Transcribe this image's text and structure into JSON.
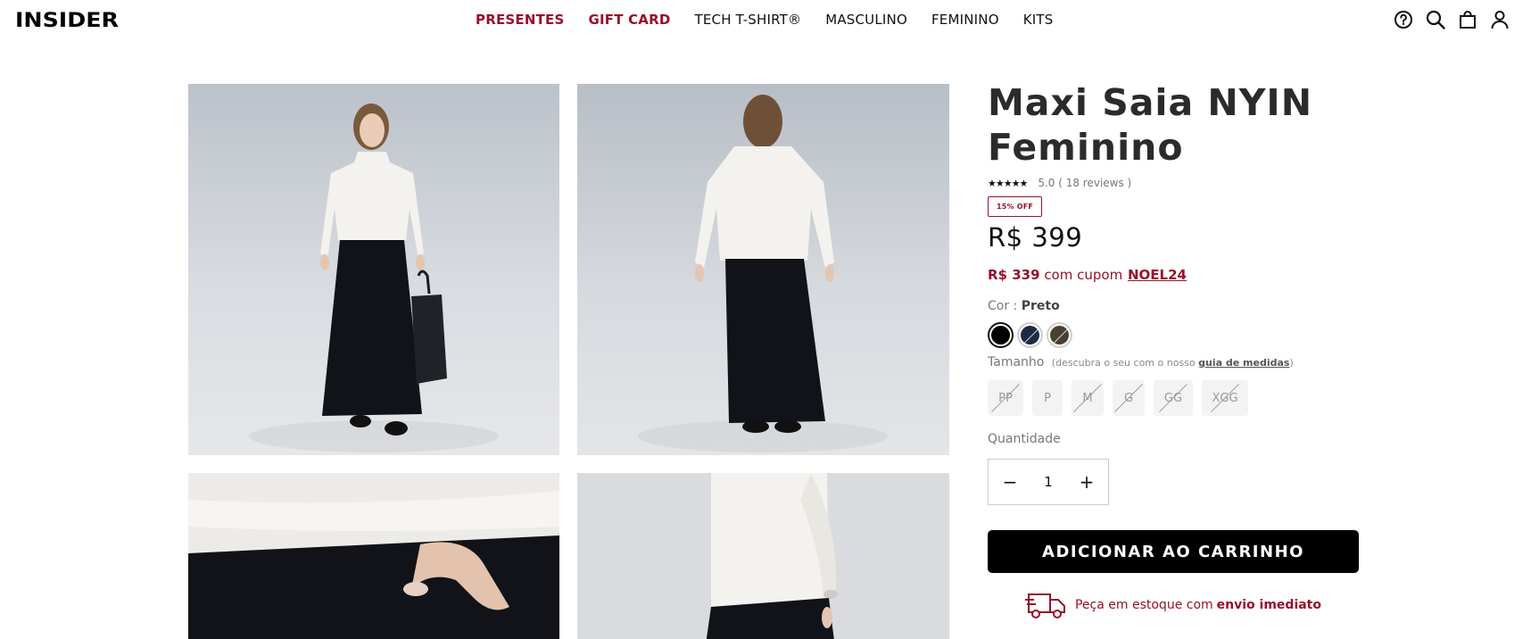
{
  "header": {
    "logo": "INSIDER",
    "nav": [
      {
        "label": "PRESENTES",
        "accent": true
      },
      {
        "label": "GIFT CARD",
        "accent": true
      },
      {
        "label": "TECH T-SHIRT®",
        "accent": false
      },
      {
        "label": "MASCULINO",
        "accent": false
      },
      {
        "label": "FEMININO",
        "accent": false
      },
      {
        "label": "KITS",
        "accent": false
      }
    ],
    "icons": [
      "help-icon",
      "search-icon",
      "bag-icon",
      "user-icon"
    ]
  },
  "gallery": {
    "photos": [
      "front-view-photo",
      "back-view-photo",
      "pocket-detail-photo",
      "side-detail-photo"
    ]
  },
  "product": {
    "title": "Maxi Saia NYIN Feminino",
    "stars": "★★★★★",
    "rating": "5.0 ( 18 reviews )",
    "discount_badge": "15% OFF",
    "price": "R$ 399",
    "coupon": {
      "price": "R$ 339",
      "text": "com cupom",
      "code": "NOEL24"
    },
    "color": {
      "label": "Cor :",
      "selected": "Preto",
      "swatches": [
        {
          "name": "Preto",
          "hex": "#000000",
          "selected": true
        },
        {
          "name": "Marinho",
          "hex": "#1c2a44",
          "selected": false
        },
        {
          "name": "Marrom",
          "hex": "#4a3f33",
          "selected": false
        }
      ]
    },
    "size": {
      "label": "Tamanho",
      "hint_prefix": "(descubra o seu com o nosso",
      "guide_link": "guia de medidas",
      "hint_suffix": ")",
      "options": [
        {
          "label": "PP",
          "available": false
        },
        {
          "label": "P",
          "available": true
        },
        {
          "label": "M",
          "available": false
        },
        {
          "label": "G",
          "available": false
        },
        {
          "label": "GG",
          "available": false
        },
        {
          "label": "XGG",
          "available": false
        }
      ]
    },
    "quantity": {
      "label": "Quantidade",
      "value": "1",
      "minus": "−",
      "plus": "+"
    },
    "add_to_cart": "ADICIONAR AO CARRINHO",
    "stock": {
      "text": "Peça em estoque com",
      "highlight": "envio imediato"
    }
  },
  "colors": {
    "accent": "#98102a",
    "primary_button": "#000000"
  }
}
